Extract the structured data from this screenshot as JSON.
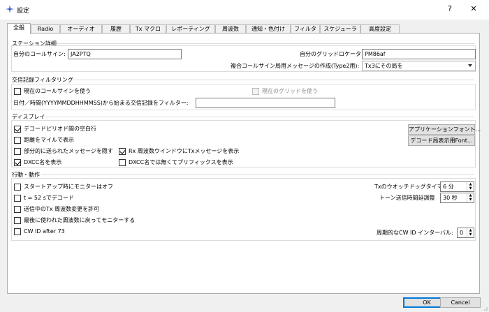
{
  "window": {
    "title": "設定",
    "help": "?",
    "close": "✕"
  },
  "tabs": [
    "全般",
    "Radio",
    "オーディオ",
    "履歴",
    "Tx マクロ",
    "レポーティング",
    "周波数",
    "通知・色付け",
    "フィルタ",
    "スケジューラ",
    "高度設定"
  ],
  "station": {
    "title": "ステーション詳細",
    "callsign_label": "自分のコールサイン:",
    "callsign_value": "JA2PTQ",
    "grid_label": "自分のグリッドロケータ:",
    "grid_value": "PM86af",
    "compound_label": "複合コールサイン局用メッセージの作成(Type2用):",
    "compound_value": "Tx3にその局を"
  },
  "log_filter": {
    "title": "交信記録フィルタリング",
    "use_callsign": "現在のコールサインを使う",
    "use_grid": "現在のグリッドを使う",
    "date_label": "日付／時間(YYYYMMDDHHMMSS)から始まる交信記録をフィルター:",
    "date_value": ""
  },
  "display": {
    "title": "ディスプレイ",
    "blank_line": "デコードピリオド間の空白行",
    "distance_miles": "距離をマイルで表示",
    "highlight_partial": "部分的に送られたメッセージを隠す",
    "rx_freq_window": "Rx 周波数ウインドウにTxメッセージを表示",
    "dxcc_name": "DXCC名を表示",
    "dxcc_prefix": "DXCC名では無くてプリフィックスを表示",
    "app_font": "アプリケーションフォント...",
    "decode_font": "デコード局表示用Font..."
  },
  "behavior": {
    "title": "行動・動作",
    "monitor_off": "スタートアップ時にモニターはオフ",
    "decode_52": "t = 52 sでデコード",
    "allow_tx_change": "送信中のTx 周波数変更を許可",
    "return_last_freq": "最後に使われた周波数に戻ってモニターする",
    "cw_id": "CW ID after 73",
    "watchdog_label": "Txのウオッチドッグタイマー",
    "watchdog_value": "6 分",
    "tune_label": "トーン送信時間延調整",
    "tune_value": "30 秒",
    "cwid_interval_label": "周期的なCW ID インターバル:",
    "cwid_interval_value": "0"
  },
  "footer": {
    "ok": "OK",
    "cancel": "Cancel"
  }
}
